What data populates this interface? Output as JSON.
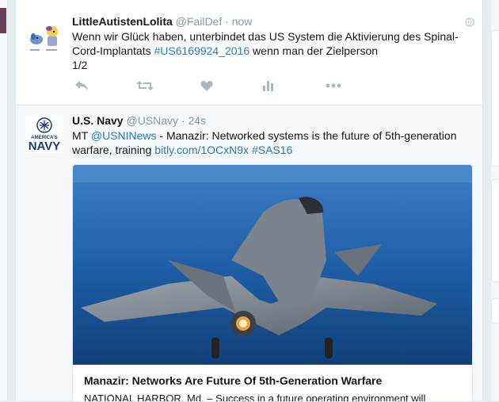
{
  "tweets": [
    {
      "fullname": "LittleAutistenLolita",
      "handle": "@FailDef",
      "separator": "·",
      "time": "now",
      "text_before": "Wenn wir Glück haben, unterbindet das US System die Aktivierung des Spinal-Cord-Implantats ",
      "hashtag": "#US6169924_2016",
      "text_after": " wenn man der Zielperson",
      "text_line3": "1/2",
      "icons": [
        "reply-icon",
        "retweet-icon",
        "like-icon",
        "analytics-icon",
        "more-icon",
        "globe-icon"
      ]
    },
    {
      "fullname": "U.S. Navy",
      "handle": "@USNavy",
      "separator": "·",
      "time": "24s",
      "text_mt": "MT ",
      "mention": "@USNINews",
      "text_mid": " - Manazir: Networked systems is the future of 5th-generation warfare, training ",
      "url": "bitly.com/1OCxN9x",
      "space": " ",
      "hashtag": "#SAS16",
      "avatar_text_top": "AMERICA'S",
      "avatar_text_bottom": "NAVY",
      "card": {
        "title": "Manazir: Networks Are Future Of 5th-Generation Warfare",
        "description": "NATIONAL HARBOR, Md. – Success in a future operating environment will"
      }
    }
  ],
  "colors": {
    "link": "#2b7bb9",
    "muted": "#8899a6",
    "card_bg": "#f5f8fa"
  }
}
